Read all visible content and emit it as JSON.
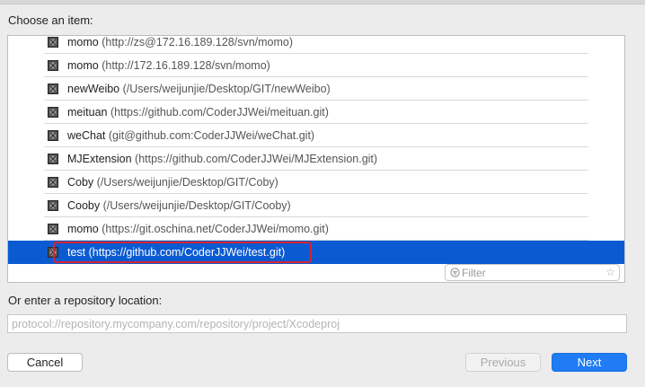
{
  "heading": "Choose an item:",
  "repositories": [
    {
      "name": "momo",
      "url": "(http://zs@172.16.189.128/svn/momo)",
      "selected": false
    },
    {
      "name": "momo",
      "url": "(http://172.16.189.128/svn/momo)",
      "selected": false
    },
    {
      "name": "newWeibo",
      "url": "(/Users/weijunjie/Desktop/GIT/newWeibo)",
      "selected": false
    },
    {
      "name": "meituan",
      "url": "(https://github.com/CoderJJWei/meituan.git)",
      "selected": false
    },
    {
      "name": "weChat",
      "url": "(git@github.com:CoderJJWei/weChat.git)",
      "selected": false
    },
    {
      "name": "MJExtension",
      "url": "(https://github.com/CoderJJWei/MJExtension.git)",
      "selected": false
    },
    {
      "name": "Coby",
      "url": "(/Users/weijunjie/Desktop/GIT/Coby)",
      "selected": false
    },
    {
      "name": "Cooby",
      "url": "(/Users/weijunjie/Desktop/GIT/Cooby)",
      "selected": false
    },
    {
      "name": "momo",
      "url": "(https://git.oschina.net/CoderJJWei/momo.git)",
      "selected": false
    },
    {
      "name": "test",
      "url": "(https://github.com/CoderJJWei/test.git)",
      "selected": true
    }
  ],
  "filter": {
    "value": "",
    "placeholder": "Filter"
  },
  "location": {
    "label": "Or enter a repository location:",
    "value": "",
    "placeholder": "protocol://repository.mycompany.com/repository/project/Xcodeproj"
  },
  "buttons": {
    "cancel": "Cancel",
    "previous": "Previous",
    "next": "Next"
  },
  "colors": {
    "selection": "#0b5ad2",
    "primary_button": "#1f7cf5",
    "highlight_border": "#d9232f"
  }
}
